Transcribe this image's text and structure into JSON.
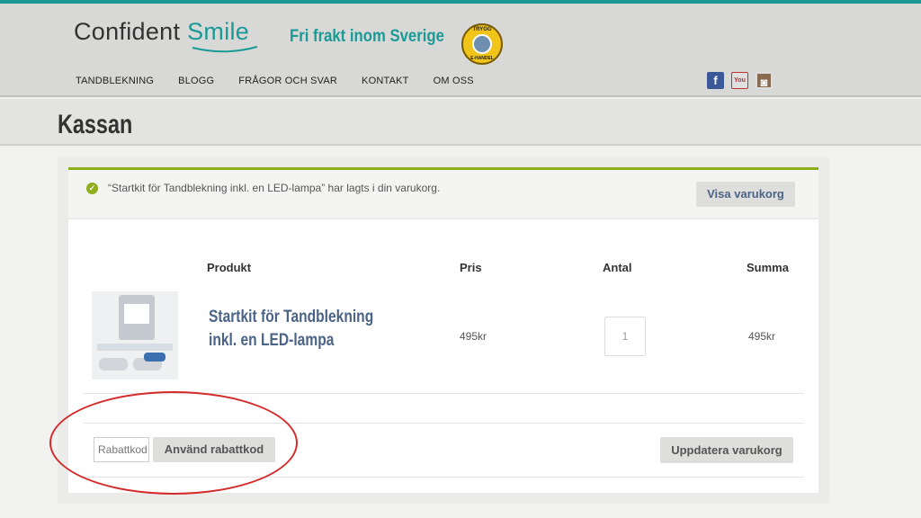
{
  "header": {
    "logo_part1": "Confident",
    "logo_part2": "Smile",
    "tagline": "Fri frakt inom Sverige",
    "badge_top": "TRYGG",
    "badge_bottom": "E-HANDEL",
    "nav": [
      "TANDBLEKNING",
      "BLOGG",
      "FRÅGOR OCH SVAR",
      "KONTAKT",
      "OM OSS"
    ],
    "social": {
      "facebook": "f",
      "youtube": "You",
      "instagram": "◙"
    }
  },
  "page": {
    "title": "Kassan"
  },
  "notice": {
    "message": "“Startkit för Tandblekning inkl. en LED-lampa” har lagts i din varukorg.",
    "view_cart_label": "Visa varukorg",
    "icon": "check-circle-icon"
  },
  "cart": {
    "columns": [
      "Produkt",
      "Pris",
      "Antal",
      "Summa"
    ],
    "item": {
      "name": "Startkit för Tandblekning inkl. en LED-lampa",
      "price": "495kr",
      "quantity": "1",
      "subtotal": "495kr"
    },
    "coupon_placeholder": "Rabattkod",
    "apply_coupon_label": "Använd rabattkod",
    "update_cart_label": "Uppdatera varukorg"
  },
  "colors": {
    "accent": "#1a9a96",
    "success": "#8fae1b",
    "link": "#4b6386",
    "annotation": "#d42a2a"
  }
}
